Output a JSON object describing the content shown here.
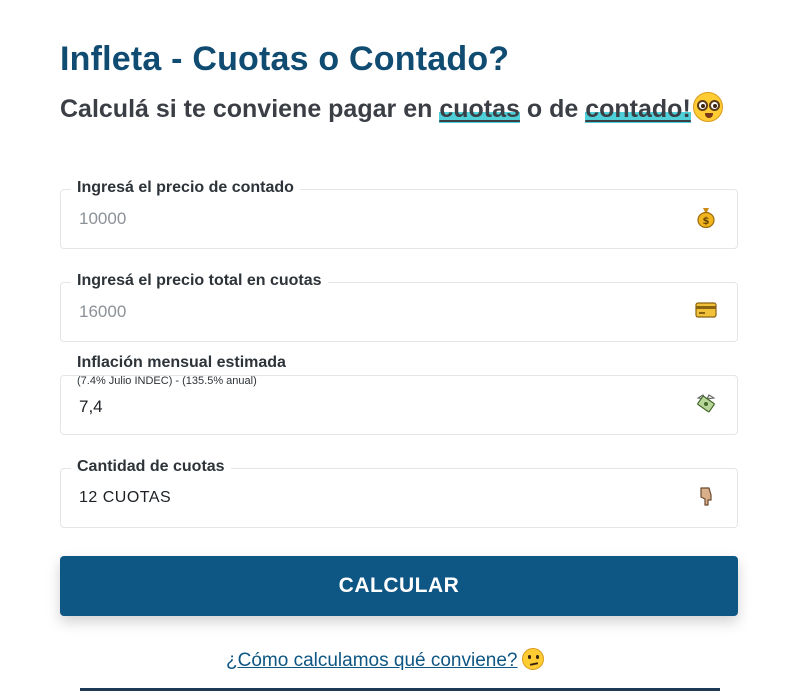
{
  "header": {
    "title": "Infleta - Cuotas o Contado?",
    "subtitle_prefix": "Calculá si te conviene pagar en",
    "subtitle_highlight1": "cuotas",
    "subtitle_middle": "o de",
    "subtitle_highlight2": "contado!",
    "subtitle_emoji": "nerd-face-icon"
  },
  "fields": {
    "cash": {
      "label": "Ingresá el precio de contado",
      "placeholder": "10000",
      "icon": "money-bag-icon"
    },
    "installments_total": {
      "label": "Ingresá el precio total en cuotas",
      "placeholder": "16000",
      "icon": "credit-card-icon"
    },
    "inflation": {
      "label": "Inflación mensual estimada",
      "note": "(7.4% Julio INDEC) - (135.5% anual)",
      "value": "7,4",
      "icon": "money-wings-icon"
    },
    "installments_count": {
      "label": "Cantidad de cuotas",
      "value": "12 CUOTAS",
      "icon": "hand-pointing-icon"
    }
  },
  "actions": {
    "calculate_label": "CALCULAR"
  },
  "help": {
    "link_text": "¿Cómo calculamos qué conviene?",
    "emoji": "thinking-face-icon"
  },
  "colors": {
    "primary": "#104b72",
    "button": "#0e5683",
    "highlight": "#4fd0d8"
  }
}
